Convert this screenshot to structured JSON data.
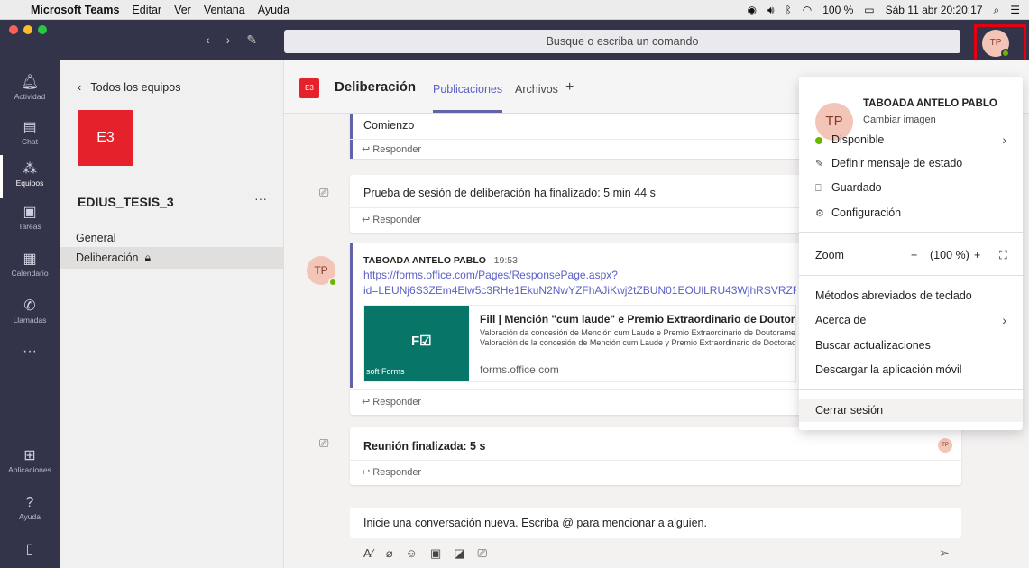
{
  "menubar": {
    "app_name": "Microsoft Teams",
    "items": [
      "Editar",
      "Ver",
      "Ventana",
      "Ayuda"
    ],
    "battery": "100 %",
    "datetime": "Sáb 11 abr 20:20:17"
  },
  "titlebar": {
    "search_placeholder": "Busque o escriba un comando",
    "user_initials": "TP"
  },
  "appbar": {
    "items": [
      {
        "label": "Actividad",
        "icon": "bell-icon"
      },
      {
        "label": "Chat",
        "icon": "chat-icon"
      },
      {
        "label": "Equipos",
        "icon": "teams-icon"
      },
      {
        "label": "Tareas",
        "icon": "tasks-icon"
      },
      {
        "label": "Calendario",
        "icon": "calendar-icon"
      },
      {
        "label": "Llamadas",
        "icon": "phone-icon"
      },
      {
        "label": "Aplicaciones",
        "icon": "apps-icon"
      },
      {
        "label": "Ayuda",
        "icon": "help-icon"
      }
    ],
    "more": "···"
  },
  "teampanel": {
    "back_label": "Todos los equipos",
    "team_tile": "E3",
    "team_name": "EDIUS_TESIS_3",
    "more": "···",
    "channels": [
      "General",
      "Deliberación"
    ]
  },
  "channel_header": {
    "tile": "E3",
    "name": "Deliberación",
    "tabs": [
      "Publicaciones",
      "Archivos"
    ],
    "add_tab": "+"
  },
  "messages": {
    "m1_text": "Comienzo",
    "reply_label": "Responder",
    "m2_text": "Prueba de sesión de deliberación ha finalizado: 5 min 44 s",
    "m3_author": "TABOADA ANTELO PABLO",
    "m3_time": "19:53",
    "m3_link_line1": "https://forms.office.com/Pages/ResponsePage.aspx?",
    "m3_link_line2": "id=LEUNj6S3ZEm4Elw5c3RHe1EkuN2NwYZFhAJiKwj2tZBUN01EOUlLRU43WjhRSVRZRklZ",
    "m3_avatar": "TP",
    "card_title": "Fill | Mención \"cum laude\" e Premio Extraordinario de Doutoramento",
    "card_desc1": "Valoración da concesión de Mención cum Laude e Premio Extraordinario de Doutoramento",
    "card_desc2": "Valoración de la concesión de Mención cum Laude y Premio Extraordinario de Doctorado",
    "card_domain": "forms.office.com",
    "card_img_label": "soft Forms",
    "m4_text": "Reunión finalizada: 5 s",
    "m4_badge": "TP"
  },
  "compose": {
    "placeholder": "Inicie una conversación nueva. Escriba @ para mencionar a alguien."
  },
  "dropdown": {
    "initials": "TP",
    "name": "TABOADA ANTELO PABLO",
    "change_image": "Cambiar imagen",
    "status": "Disponible",
    "set_status": "Definir mensaje de estado",
    "saved": "Guardado",
    "settings": "Configuración",
    "zoom_label": "Zoom",
    "zoom_minus": "−",
    "zoom_value": "(100 %)",
    "zoom_plus": "+",
    "shortcuts": "Métodos abreviados de teclado",
    "about": "Acerca de",
    "updates": "Buscar actualizaciones",
    "download": "Descargar la aplicación móvil",
    "signout": "Cerrar sesión"
  },
  "colors": {
    "brand": "#6264a7",
    "titlebar": "#33344a",
    "team_tile": "#e5222b",
    "available": "#6bb700",
    "highlight_box": "#e5000f"
  }
}
